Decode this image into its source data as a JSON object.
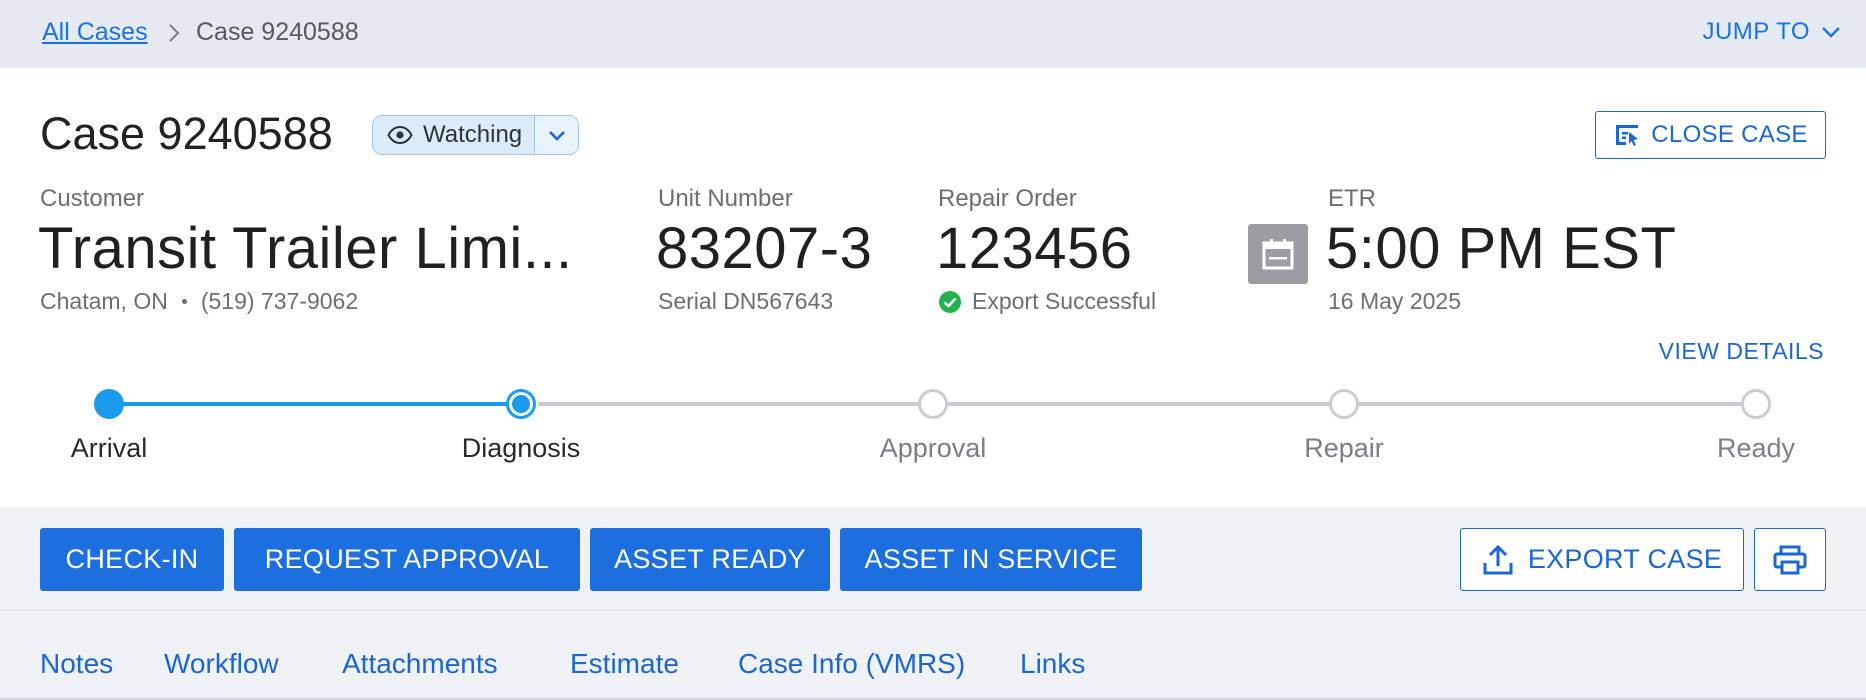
{
  "breadcrumb": {
    "root": "All Cases",
    "current": "Case 9240588",
    "jump_to": "JUMP TO"
  },
  "header": {
    "title": "Case 9240588",
    "watch_label": "Watching",
    "close_case": "CLOSE CASE"
  },
  "summary": {
    "customer": {
      "label": "Customer",
      "name": "Transit Trailer Limi...",
      "location": "Chatam, ON",
      "phone": "(519) 737-9062"
    },
    "unit": {
      "label": "Unit Number",
      "value": "83207-3",
      "serial": "Serial DN567643"
    },
    "repair_order": {
      "label": "Repair Order",
      "value": "123456",
      "status": "Export Successful"
    },
    "etr": {
      "label": "ETR",
      "time": "5:00 PM EST",
      "date": "16 May 2025"
    },
    "view_details": "VIEW DETAILS"
  },
  "stepper": {
    "steps": [
      {
        "label": "Arrival",
        "state": "done"
      },
      {
        "label": "Diagnosis",
        "state": "current"
      },
      {
        "label": "Approval",
        "state": "pending"
      },
      {
        "label": "Repair",
        "state": "pending"
      },
      {
        "label": "Ready",
        "state": "pending"
      }
    ]
  },
  "actions": {
    "check_in": "CHECK-IN",
    "request_approval": "REQUEST APPROVAL",
    "asset_ready": "ASSET READY",
    "asset_in_service": "ASSET IN SERVICE",
    "export_case": "EXPORT CASE"
  },
  "tabs": [
    "Notes",
    "Workflow",
    "Attachments",
    "Estimate",
    "Case Info (VMRS)",
    "Links"
  ],
  "colors": {
    "primary": "#1d6fe0",
    "link": "#1a66d4",
    "stepper_active": "#1a9bf0",
    "stepper_pending": "#c9ccd2",
    "success": "#22b14c"
  },
  "icons": {
    "breadcrumb_separator": "chevron-right-icon",
    "jump_to": "chevron-down-icon",
    "watch": "eye-icon",
    "close_case": "close-case-icon",
    "etr": "calendar-icon",
    "export_status": "check-circle-icon",
    "export_case": "upload-icon",
    "print": "printer-icon"
  }
}
